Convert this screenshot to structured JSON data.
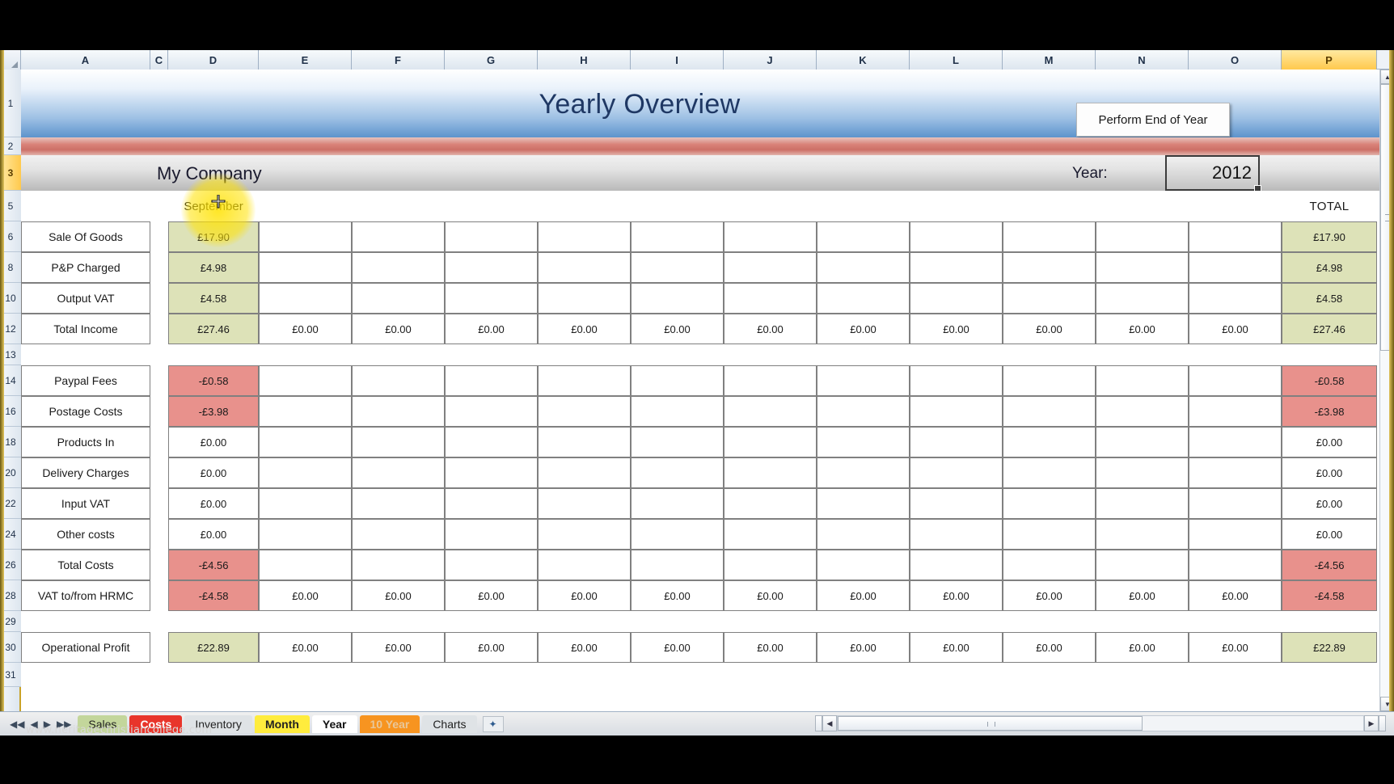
{
  "window": {
    "watermark": "www.heritagechristiancollege.com"
  },
  "columns": {
    "headers": [
      "A",
      "C",
      "D",
      "E",
      "F",
      "G",
      "H",
      "I",
      "J",
      "K",
      "L",
      "M",
      "N",
      "O",
      "P"
    ],
    "selected": "P"
  },
  "rows": {
    "numbers": [
      "1",
      "2",
      "3",
      "5",
      "6",
      "8",
      "10",
      "12",
      "13",
      "14",
      "16",
      "18",
      "20",
      "22",
      "24",
      "26",
      "28",
      "29",
      "30",
      "31"
    ],
    "selected": "3"
  },
  "banner": {
    "title": "Yearly Overview",
    "button_label": "Perform End of Year"
  },
  "company_band": {
    "company_name": "My Company",
    "year_label": "Year:",
    "year_value": "2012"
  },
  "grid": {
    "month_header": "September",
    "total_header": "TOTAL",
    "rows": [
      {
        "label": "Sale Of Goods",
        "style": "green",
        "month": "£17.90",
        "others": [
          "",
          "",
          "",
          "",
          "",
          "",
          "",
          "",
          "",
          "",
          ""
        ],
        "total": "£17.90"
      },
      {
        "label": "P&P Charged",
        "style": "green",
        "month": "£4.98",
        "others": [
          "",
          "",
          "",
          "",
          "",
          "",
          "",
          "",
          "",
          "",
          ""
        ],
        "total": "£4.98"
      },
      {
        "label": "Output VAT",
        "style": "green",
        "month": "£4.58",
        "others": [
          "",
          "",
          "",
          "",
          "",
          "",
          "",
          "",
          "",
          "",
          ""
        ],
        "total": "£4.58"
      },
      {
        "label": "Total Income",
        "style": "green",
        "month": "£27.46",
        "others": [
          "£0.00",
          "£0.00",
          "£0.00",
          "£0.00",
          "£0.00",
          "£0.00",
          "£0.00",
          "£0.00",
          "£0.00",
          "£0.00",
          "£0.00"
        ],
        "total": "£27.46"
      },
      {
        "label": "Paypal Fees",
        "style": "red",
        "month": "-£0.58",
        "others": [
          "",
          "",
          "",
          "",
          "",
          "",
          "",
          "",
          "",
          "",
          ""
        ],
        "total": "-£0.58"
      },
      {
        "label": "Postage Costs",
        "style": "red",
        "month": "-£3.98",
        "others": [
          "",
          "",
          "",
          "",
          "",
          "",
          "",
          "",
          "",
          "",
          ""
        ],
        "total": "-£3.98"
      },
      {
        "label": "Products In",
        "style": "plain",
        "month": "£0.00",
        "others": [
          "",
          "",
          "",
          "",
          "",
          "",
          "",
          "",
          "",
          "",
          ""
        ],
        "total": "£0.00"
      },
      {
        "label": "Delivery Charges",
        "style": "plain",
        "month": "£0.00",
        "others": [
          "",
          "",
          "",
          "",
          "",
          "",
          "",
          "",
          "",
          "",
          ""
        ],
        "total": "£0.00"
      },
      {
        "label": "Input VAT",
        "style": "plain",
        "month": "£0.00",
        "others": [
          "",
          "",
          "",
          "",
          "",
          "",
          "",
          "",
          "",
          "",
          ""
        ],
        "total": "£0.00"
      },
      {
        "label": "Other costs",
        "style": "plain",
        "month": "£0.00",
        "others": [
          "",
          "",
          "",
          "",
          "",
          "",
          "",
          "",
          "",
          "",
          ""
        ],
        "total": "£0.00"
      },
      {
        "label": "Total Costs",
        "style": "red",
        "month": "-£4.56",
        "others": [
          "",
          "",
          "",
          "",
          "",
          "",
          "",
          "",
          "",
          "",
          ""
        ],
        "total": "-£4.56"
      },
      {
        "label": "VAT to/from HRMC",
        "style": "red",
        "month": "-£4.58",
        "others": [
          "£0.00",
          "£0.00",
          "£0.00",
          "£0.00",
          "£0.00",
          "£0.00",
          "£0.00",
          "£0.00",
          "£0.00",
          "£0.00",
          "£0.00"
        ],
        "total": "-£4.58"
      },
      {
        "label": "Operational Profit",
        "style": "green",
        "month": "£22.89",
        "others": [
          "£0.00",
          "£0.00",
          "£0.00",
          "£0.00",
          "£0.00",
          "£0.00",
          "£0.00",
          "£0.00",
          "£0.00",
          "£0.00",
          "£0.00"
        ],
        "total": "£22.89"
      }
    ]
  },
  "tabbar": {
    "nav": {
      "first": "◀◀",
      "prev": "◀",
      "next": "▶",
      "last": "▶▶"
    },
    "tabs": [
      {
        "label": "Sales",
        "color": "tab-green"
      },
      {
        "label": "Costs",
        "color": "tab-red"
      },
      {
        "label": "Inventory",
        "color": "tab-grey"
      },
      {
        "label": "Month",
        "color": "tab-yellow"
      },
      {
        "label": "Year",
        "color": "active"
      },
      {
        "label": "10 Year",
        "color": "tab-orange"
      },
      {
        "label": "Charts",
        "color": "tab-grey"
      }
    ],
    "new_sheet_icon": "✦"
  },
  "scrollbars": {
    "h_left": "◀",
    "h_right": "▶",
    "v_up": "▲",
    "v_down": "▼"
  }
}
